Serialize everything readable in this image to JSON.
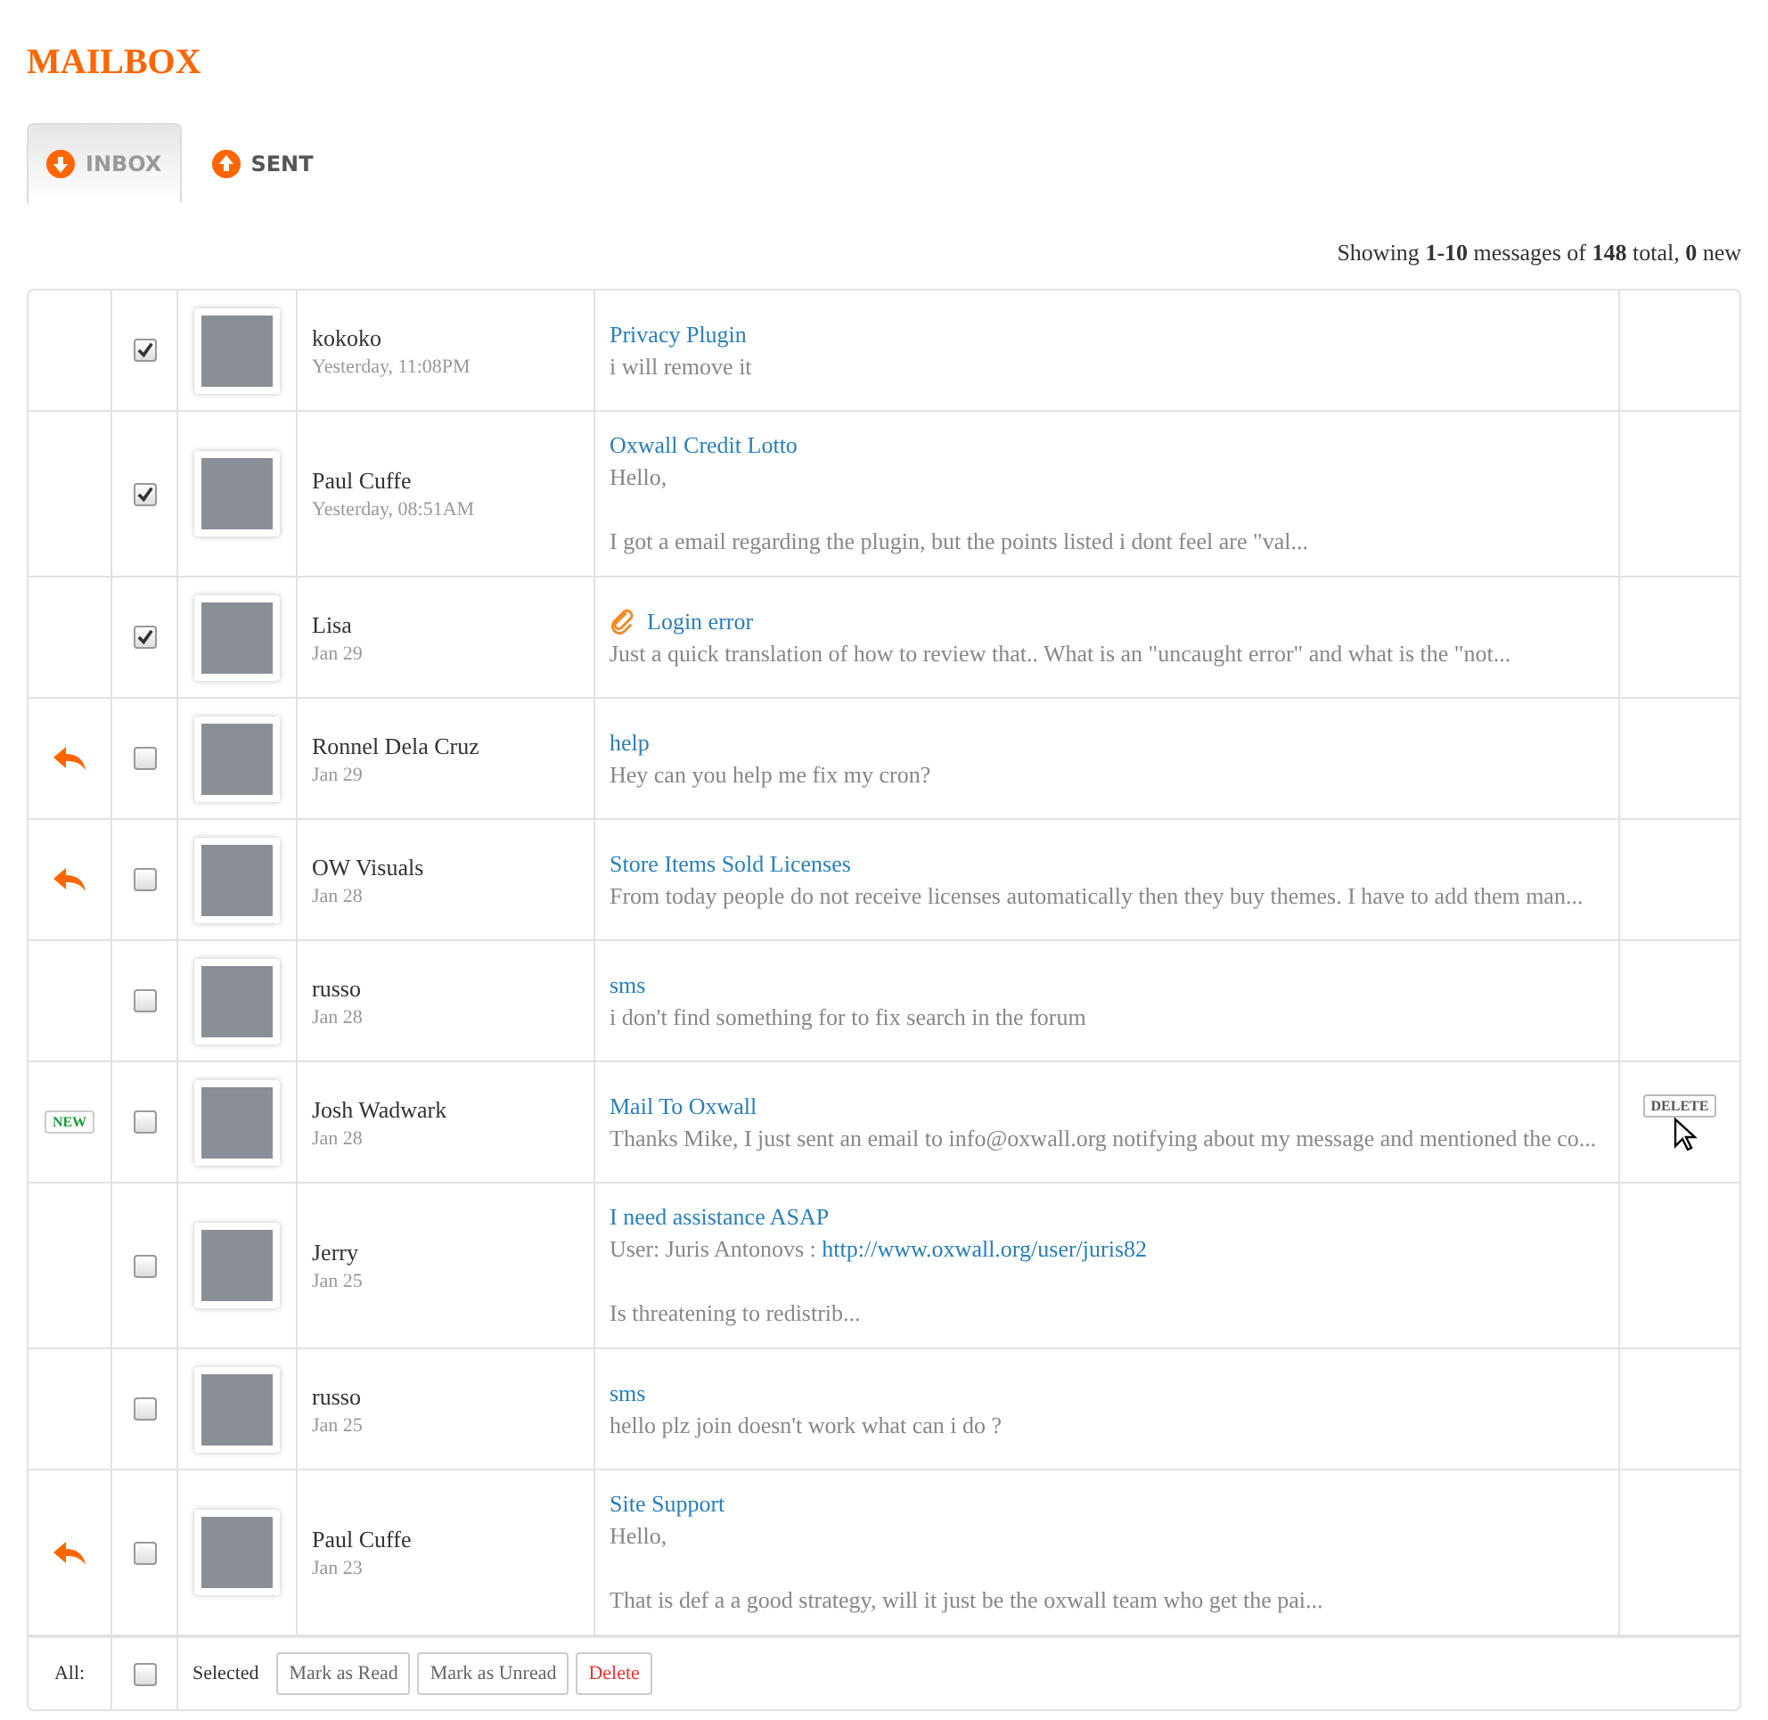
{
  "title": "MAILBOX",
  "tabs": [
    {
      "label": "INBOX",
      "selected": true
    },
    {
      "label": "SENT",
      "selected": false
    }
  ],
  "summary": "Showing **1-10** messages of **148** total, **0** new",
  "messages": [
    {
      "replied": false,
      "checked": true,
      "sender": "kokoko",
      "date": "Yesterday, 11:08PM",
      "subject": "Privacy Plugin",
      "attachment": false,
      "hovered": false,
      "preview": [
        [
          {
            "text": "i will remove it"
          }
        ]
      ]
    },
    {
      "replied": false,
      "checked": true,
      "sender": "Paul Cuffe",
      "date": "Yesterday, 08:51AM",
      "subject": "Oxwall Credit Lotto",
      "attachment": false,
      "hovered": false,
      "preview": [
        [
          {
            "text": "Hello,"
          }
        ],
        [
          {
            "text": "I got a email regarding the plugin, but the points listed i dont feel are \"val..."
          }
        ]
      ]
    },
    {
      "replied": false,
      "checked": true,
      "sender": "Lisa",
      "date": "Jan 29",
      "subject": "Login error",
      "attachment": true,
      "hovered": false,
      "preview": [
        [
          {
            "text": "Just a quick translation of how to review that.. What is an \"uncaught error\" and what is the \"not..."
          }
        ]
      ]
    },
    {
      "replied": true,
      "checked": false,
      "sender": "Ronnel Dela Cruz",
      "date": "Jan 29",
      "subject": "help",
      "attachment": false,
      "hovered": false,
      "preview": [
        [
          {
            "text": "Hey can you help me fix my cron?"
          }
        ]
      ]
    },
    {
      "replied": true,
      "checked": false,
      "sender": "OW Visuals",
      "date": "Jan 28",
      "subject": "Store Items Sold Licenses",
      "attachment": false,
      "hovered": false,
      "preview": [
        [
          {
            "text": "From today people do not receive licenses automatically then they buy themes. I have to add them man..."
          }
        ]
      ]
    },
    {
      "replied": false,
      "checked": false,
      "sender": "russo",
      "date": "Jan 28",
      "subject": "sms",
      "attachment": false,
      "hovered": false,
      "preview": [
        [
          {
            "text": "i don't find something for to fix search in the forum"
          }
        ]
      ]
    },
    {
      "replied": false,
      "badge": "NEW",
      "checked": false,
      "sender": "Josh Wadwark",
      "date": "Jan 28",
      "subject": "Mail To Oxwall",
      "attachment": false,
      "hovered": true,
      "delete_label": "DELETE",
      "preview": [
        [
          {
            "text": "Thanks Mike, I just sent an email to info@oxwall.org notifying about my message and mentioned the co..."
          }
        ]
      ]
    },
    {
      "replied": false,
      "checked": false,
      "sender": "Jerry",
      "date": "Jan 25",
      "subject": "I need assistance ASAP",
      "attachment": false,
      "hovered": false,
      "preview": [
        [
          {
            "text": "User: Juris Antonovs : "
          },
          {
            "link": "http://www.oxwall.org/user/juris82"
          }
        ],
        [
          {
            "text": "Is threatening to redistrib..."
          }
        ]
      ]
    },
    {
      "replied": false,
      "checked": false,
      "sender": "russo",
      "date": "Jan 25",
      "subject": "sms",
      "attachment": false,
      "hovered": false,
      "preview": [
        [
          {
            "text": "hello plz join doesn't work what can i do ?"
          }
        ]
      ]
    },
    {
      "replied": true,
      "checked": false,
      "sender": "Paul Cuffe",
      "date": "Jan 23",
      "subject": "Site Support",
      "attachment": false,
      "hovered": false,
      "preview": [
        [
          {
            "text": "Hello,"
          }
        ],
        [
          {
            "text": "That is def a a good strategy, will it just be the oxwall team who get the pai..."
          }
        ]
      ]
    }
  ],
  "footer": {
    "all_label": "All:",
    "all_checked": false,
    "selected_label": "Selected",
    "actions": [
      {
        "label": "Mark as Read",
        "kind": "normal"
      },
      {
        "label": "Mark as Unread",
        "kind": "normal"
      },
      {
        "label": "Delete",
        "kind": "danger"
      }
    ]
  }
}
